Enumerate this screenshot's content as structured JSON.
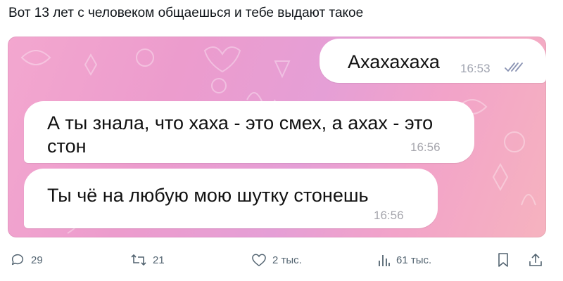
{
  "post": {
    "caption": "Вот 13 лет с человеком общаешься и тебе выдают такое"
  },
  "chat": {
    "messages": [
      {
        "direction": "outgoing",
        "text": "Ахахахаха",
        "time": "16:53",
        "read_icon": "double-check-icon"
      },
      {
        "direction": "incoming",
        "text": "А ты знала, что хаха - это смех, а ахах - это стон",
        "time": "16:56"
      },
      {
        "direction": "incoming",
        "text": "Ты чё на любую мою шутку стонешь",
        "time": "16:56"
      }
    ],
    "background_colors": [
      "#f3a7cf",
      "#e59fd6",
      "#f6b3bf"
    ],
    "bubble_color": "#ffffff"
  },
  "actions": {
    "reply_count": "29",
    "retweet_count": "21",
    "like_count": "2 тыс.",
    "views_count": "61 тыс.",
    "icons": [
      "reply-icon",
      "retweet-icon",
      "like-icon",
      "views-icon",
      "bookmark-icon",
      "share-icon"
    ],
    "icon_color": "#536471"
  }
}
